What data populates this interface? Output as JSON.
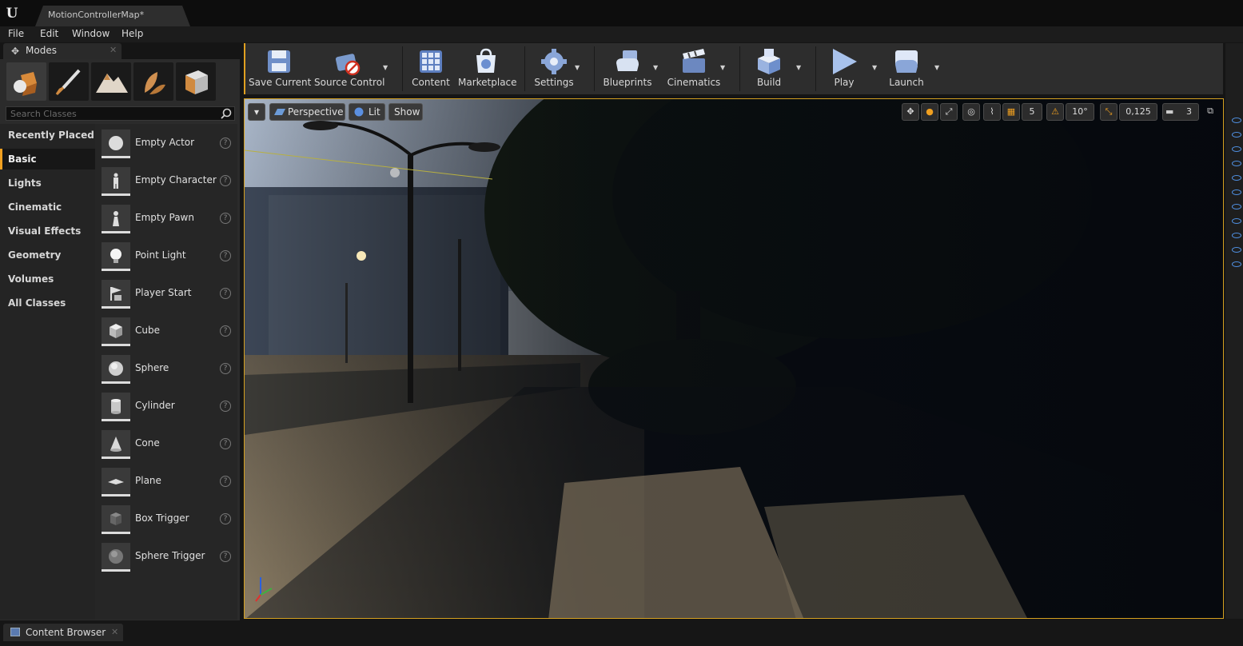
{
  "window": {
    "tab_title": "MotionControllerMap*"
  },
  "menu": [
    "File",
    "Edit",
    "Window",
    "Help"
  ],
  "modes_panel": {
    "tab_label": "Modes",
    "mode_icons": [
      "place-mode-icon",
      "paint-mode-icon",
      "landscape-mode-icon",
      "foliage-mode-icon",
      "geometry-mode-icon"
    ],
    "search_placeholder": "Search Classes",
    "categories": [
      "Recently Placed",
      "Basic",
      "Lights",
      "Cinematic",
      "Visual Effects",
      "Geometry",
      "Volumes",
      "All Classes"
    ],
    "active_category": "Basic",
    "items": [
      {
        "name": "Empty Actor",
        "icon": "sphere"
      },
      {
        "name": "Empty Character",
        "icon": "character"
      },
      {
        "name": "Empty Pawn",
        "icon": "pawn"
      },
      {
        "name": "Point Light",
        "icon": "bulb"
      },
      {
        "name": "Player Start",
        "icon": "flag"
      },
      {
        "name": "Cube",
        "icon": "cube"
      },
      {
        "name": "Sphere",
        "icon": "sphere"
      },
      {
        "name": "Cylinder",
        "icon": "cylinder"
      },
      {
        "name": "Cone",
        "icon": "cone"
      },
      {
        "name": "Plane",
        "icon": "plane"
      },
      {
        "name": "Box Trigger",
        "icon": "box"
      },
      {
        "name": "Sphere Trigger",
        "icon": "sphere"
      }
    ]
  },
  "toolbar": {
    "buttons": [
      {
        "label": "Save Current",
        "icon": "save-icon",
        "dropdown": false
      },
      {
        "label": "Source Control",
        "icon": "source-control-icon",
        "dropdown": true
      },
      {
        "label": "Content",
        "icon": "content-icon",
        "dropdown": false
      },
      {
        "label": "Marketplace",
        "icon": "marketplace-icon",
        "dropdown": false
      },
      {
        "label": "Settings",
        "icon": "settings-icon",
        "dropdown": true
      },
      {
        "label": "Blueprints",
        "icon": "blueprints-icon",
        "dropdown": true
      },
      {
        "label": "Cinematics",
        "icon": "cinematics-icon",
        "dropdown": true
      },
      {
        "label": "Build",
        "icon": "build-icon",
        "dropdown": true
      },
      {
        "label": "Play",
        "icon": "play-icon",
        "dropdown": true
      },
      {
        "label": "Launch",
        "icon": "launch-icon",
        "dropdown": true
      }
    ]
  },
  "viewport": {
    "view_mode": "Perspective",
    "lighting": "Lit",
    "show": "Show",
    "grid_snap": "5",
    "rotation_snap": "10°",
    "scale_snap": "0,125",
    "camera_speed": "3"
  },
  "bottom": {
    "content_browser_label": "Content Browser"
  },
  "colors": {
    "accent": "#e0a020",
    "selection": "#f0a020",
    "eye_blue": "#4f8fe0"
  }
}
